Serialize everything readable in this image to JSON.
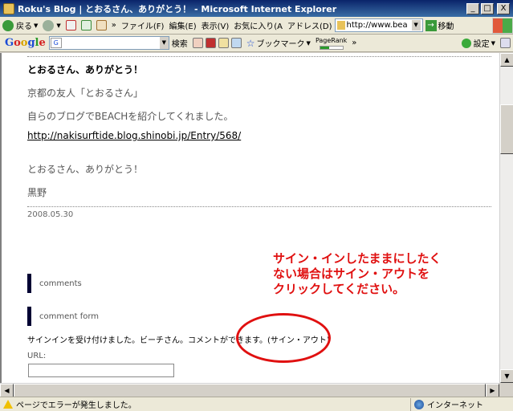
{
  "window": {
    "title": "Roku's Blog | とおるさん、ありがとう！ - Microsoft Internet Explorer",
    "minimize": "_",
    "maximize": "□",
    "close": "X"
  },
  "toolbar": {
    "back": "戻る",
    "file_menu": "ファイル(F)",
    "edit_menu": "編集(E)",
    "view_menu": "表示(V)",
    "favorites_menu": "お気に入り(A",
    "chevron": "»",
    "address_label": "アドレス(D)",
    "address_value": "http://www.bea",
    "go_label": "移動"
  },
  "google_toolbar": {
    "search_label": "検索",
    "bookmark_label": "ブックマーク",
    "pagerank_label": "PageRank",
    "settings_label": "設定",
    "chevron": "»",
    "pagerank_value": 0.4
  },
  "post": {
    "title": "とおるさん、ありがとう！",
    "line1": "京都の友人「とおるさん」",
    "line2": "自らのブログでBEACHを紹介してくれました。",
    "link": "http://nakisurftide.blog.shinobi.jp/Entry/568/",
    "line3": "とおるさん、ありがとう！",
    "signature": "黒野",
    "date": "2008.05.30"
  },
  "sections": {
    "comments": "comments",
    "comment_form": "comment form"
  },
  "form": {
    "signin_note": "サインインを受け付けました。ビーチさん。コメントができます。(サイン・アウト)",
    "url_label": "URL:",
    "url_value": ""
  },
  "annotation": {
    "text": "サイン・インしたままにしたく\nない場合はサイン・アウトを\nクリックしてください。",
    "color": "#e01010"
  },
  "statusbar": {
    "text": "ページでエラーが発生しました。",
    "zone": "インターネット"
  }
}
